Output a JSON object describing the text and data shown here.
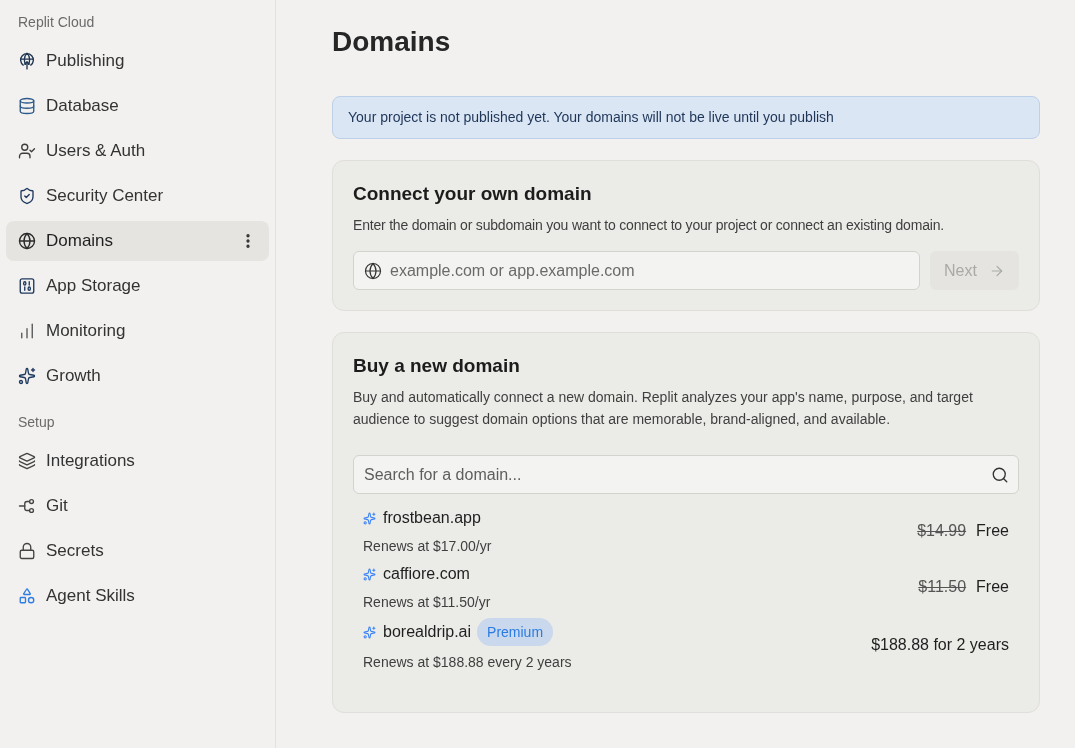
{
  "sidebar": {
    "sections": [
      {
        "title": "Replit Cloud",
        "items": [
          {
            "label": "Publishing",
            "selected": false
          },
          {
            "label": "Database",
            "selected": false
          },
          {
            "label": "Users & Auth",
            "selected": false
          },
          {
            "label": "Security Center",
            "selected": false
          },
          {
            "label": "Domains",
            "selected": true
          },
          {
            "label": "App Storage",
            "selected": false
          },
          {
            "label": "Monitoring",
            "selected": false
          },
          {
            "label": "Growth",
            "selected": false
          }
        ]
      },
      {
        "title": "Setup",
        "items": [
          {
            "label": "Integrations",
            "selected": false
          },
          {
            "label": "Git",
            "selected": false
          },
          {
            "label": "Secrets",
            "selected": false
          },
          {
            "label": "Agent Skills",
            "selected": false
          }
        ]
      }
    ]
  },
  "page": {
    "title": "Domains"
  },
  "notice": {
    "text": "Your project is not published yet. Your domains will not be live until you publish"
  },
  "connect_card": {
    "title": "Connect your own domain",
    "description": "Enter the domain or subdomain you want to connect to your project or connect an existing domain.",
    "input": {
      "placeholder": "example.com or app.example.com"
    },
    "next_button": {
      "label": "Next",
      "disabled": true
    }
  },
  "buy_card": {
    "title": "Buy a new domain",
    "description": "Buy and automatically connect a new domain. Replit analyzes your app's name, purpose, and target audience to suggest domain options that are memorable, brand-aligned, and available.",
    "search": {
      "placeholder": "Search for a domain..."
    },
    "suggestions": [
      {
        "name": "frostbean.app",
        "renewal": "Renews at $17.00/yr",
        "original_price": "$14.99",
        "price": "Free"
      },
      {
        "name": "caffiore.com",
        "renewal": "Renews at $11.50/yr",
        "original_price": "$11.50",
        "price": "Free"
      },
      {
        "name": "borealdrip.ai",
        "badge": "Premium",
        "renewal": "Renews at $188.88 every 2 years",
        "price": "$188.88 for 2 years"
      }
    ]
  }
}
